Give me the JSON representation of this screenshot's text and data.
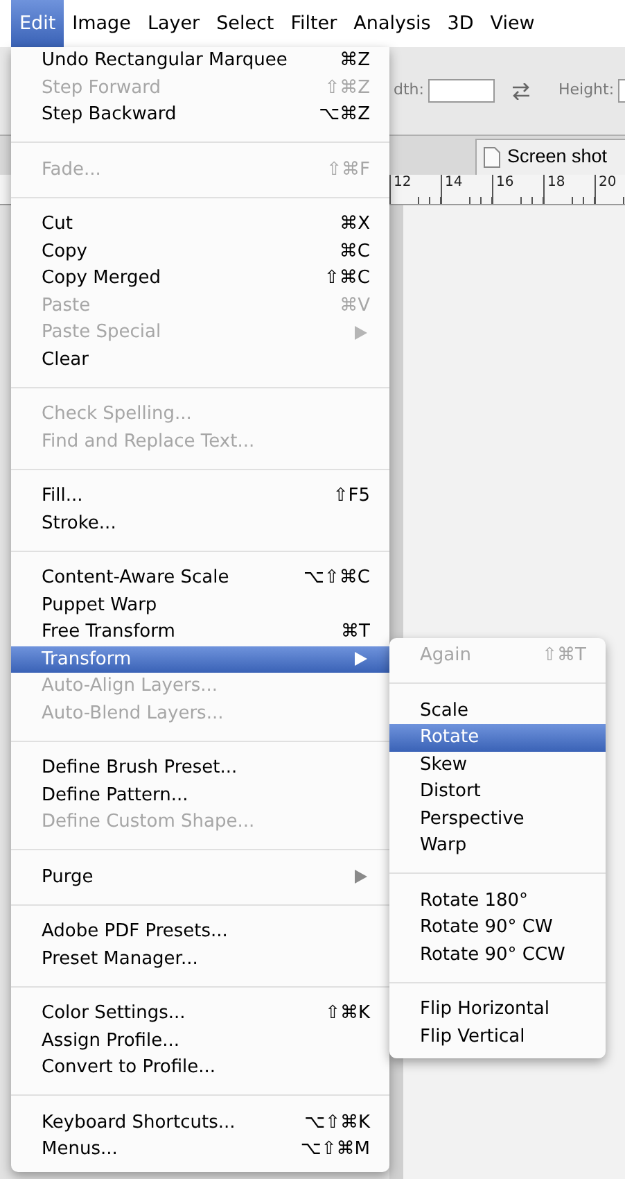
{
  "menu_bar": [
    {
      "label": "Edit",
      "selected": true
    },
    {
      "label": "Image",
      "selected": false
    },
    {
      "label": "Layer",
      "selected": false
    },
    {
      "label": "Select",
      "selected": false
    },
    {
      "label": "Filter",
      "selected": false
    },
    {
      "label": "Analysis",
      "selected": false
    },
    {
      "label": "3D",
      "selected": false
    },
    {
      "label": "View",
      "selected": false
    }
  ],
  "toolbar": {
    "width_label": "dth:",
    "height_label": "Height:"
  },
  "document_tab": {
    "title": "Screen shot"
  },
  "ruler": {
    "labels": [
      "12",
      "14",
      "16",
      "18",
      "20"
    ]
  },
  "edit_menu": {
    "groups": [
      [
        {
          "label": "Undo Rectangular Marquee",
          "shortcut": "⌘Z",
          "disabled": false,
          "selected": false,
          "has_submenu": false
        },
        {
          "label": "Step Forward",
          "shortcut": "⇧⌘Z",
          "disabled": true,
          "selected": false,
          "has_submenu": false
        },
        {
          "label": "Step Backward",
          "shortcut": "⌥⌘Z",
          "disabled": false,
          "selected": false,
          "has_submenu": false
        }
      ],
      [
        {
          "label": "Fade...",
          "shortcut": "⇧⌘F",
          "disabled": true,
          "selected": false,
          "has_submenu": false
        }
      ],
      [
        {
          "label": "Cut",
          "shortcut": "⌘X",
          "disabled": false,
          "selected": false,
          "has_submenu": false
        },
        {
          "label": "Copy",
          "shortcut": "⌘C",
          "disabled": false,
          "selected": false,
          "has_submenu": false
        },
        {
          "label": "Copy Merged",
          "shortcut": "⇧⌘C",
          "disabled": false,
          "selected": false,
          "has_submenu": false
        },
        {
          "label": "Paste",
          "shortcut": "⌘V",
          "disabled": true,
          "selected": false,
          "has_submenu": false
        },
        {
          "label": "Paste Special",
          "disabled": true,
          "selected": false,
          "has_submenu": true
        },
        {
          "label": "Clear",
          "disabled": false,
          "selected": false,
          "has_submenu": false
        }
      ],
      [
        {
          "label": "Check Spelling...",
          "disabled": true,
          "selected": false,
          "has_submenu": false
        },
        {
          "label": "Find and Replace Text...",
          "disabled": true,
          "selected": false,
          "has_submenu": false
        }
      ],
      [
        {
          "label": "Fill...",
          "shortcut": "⇧F5",
          "disabled": false,
          "selected": false,
          "has_submenu": false
        },
        {
          "label": "Stroke...",
          "disabled": false,
          "selected": false,
          "has_submenu": false
        }
      ],
      [
        {
          "label": "Content-Aware Scale",
          "shortcut": "⌥⇧⌘C",
          "disabled": false,
          "selected": false,
          "has_submenu": false
        },
        {
          "label": "Puppet Warp",
          "disabled": false,
          "selected": false,
          "has_submenu": false
        },
        {
          "label": "Free Transform",
          "shortcut": "⌘T",
          "disabled": false,
          "selected": false,
          "has_submenu": false
        },
        {
          "label": "Transform",
          "disabled": false,
          "selected": true,
          "has_submenu": true
        },
        {
          "label": "Auto-Align Layers...",
          "disabled": true,
          "selected": false,
          "has_submenu": false
        },
        {
          "label": "Auto-Blend Layers...",
          "disabled": true,
          "selected": false,
          "has_submenu": false
        }
      ],
      [
        {
          "label": "Define Brush Preset...",
          "disabled": false,
          "selected": false,
          "has_submenu": false
        },
        {
          "label": "Define Pattern...",
          "disabled": false,
          "selected": false,
          "has_submenu": false
        },
        {
          "label": "Define Custom Shape...",
          "disabled": true,
          "selected": false,
          "has_submenu": false
        }
      ],
      [
        {
          "label": "Purge",
          "disabled": false,
          "selected": false,
          "has_submenu": true
        }
      ],
      [
        {
          "label": "Adobe PDF Presets...",
          "disabled": false,
          "selected": false,
          "has_submenu": false
        },
        {
          "label": "Preset Manager...",
          "disabled": false,
          "selected": false,
          "has_submenu": false
        }
      ],
      [
        {
          "label": "Color Settings...",
          "shortcut": "⇧⌘K",
          "disabled": false,
          "selected": false,
          "has_submenu": false
        },
        {
          "label": "Assign Profile...",
          "disabled": false,
          "selected": false,
          "has_submenu": false
        },
        {
          "label": "Convert to Profile...",
          "disabled": false,
          "selected": false,
          "has_submenu": false
        }
      ],
      [
        {
          "label": "Keyboard Shortcuts...",
          "shortcut": "⌥⇧⌘K",
          "disabled": false,
          "selected": false,
          "has_submenu": false
        },
        {
          "label": "Menus...",
          "shortcut": "⌥⇧⌘M",
          "disabled": false,
          "selected": false,
          "has_submenu": false
        }
      ]
    ]
  },
  "transform_submenu": {
    "groups": [
      [
        {
          "label": "Again",
          "shortcut": "⇧⌘T",
          "disabled": true,
          "selected": false,
          "has_submenu": false
        }
      ],
      [
        {
          "label": "Scale",
          "disabled": false,
          "selected": false,
          "has_submenu": false
        },
        {
          "label": "Rotate",
          "disabled": false,
          "selected": true,
          "has_submenu": false
        },
        {
          "label": "Skew",
          "disabled": false,
          "selected": false,
          "has_submenu": false
        },
        {
          "label": "Distort",
          "disabled": false,
          "selected": false,
          "has_submenu": false
        },
        {
          "label": "Perspective",
          "disabled": false,
          "selected": false,
          "has_submenu": false
        },
        {
          "label": "Warp",
          "disabled": false,
          "selected": false,
          "has_submenu": false
        }
      ],
      [
        {
          "label": "Rotate 180°",
          "disabled": false,
          "selected": false,
          "has_submenu": false
        },
        {
          "label": "Rotate 90° CW",
          "disabled": false,
          "selected": false,
          "has_submenu": false
        },
        {
          "label": "Rotate 90° CCW",
          "disabled": false,
          "selected": false,
          "has_submenu": false
        }
      ],
      [
        {
          "label": "Flip Horizontal",
          "disabled": false,
          "selected": false,
          "has_submenu": false
        },
        {
          "label": "Flip Vertical",
          "disabled": false,
          "selected": false,
          "has_submenu": false
        }
      ]
    ]
  }
}
